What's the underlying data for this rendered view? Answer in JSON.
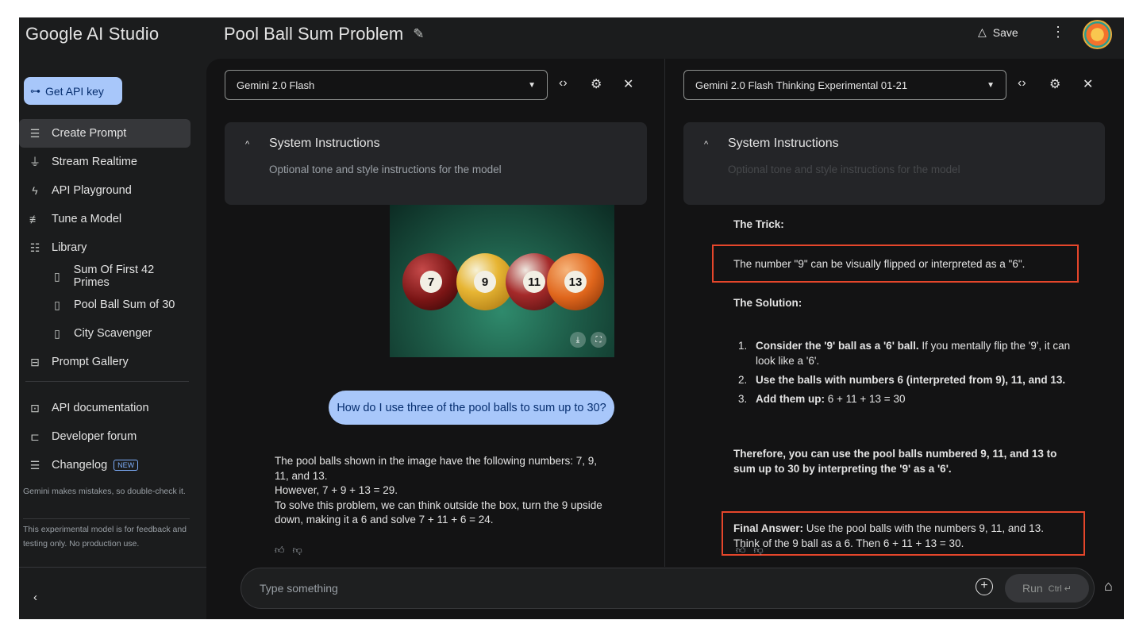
{
  "app": {
    "brand": "Google AI Studio",
    "title": "Pool Ball Sum Problem",
    "save_label": "Save"
  },
  "sidebar": {
    "api_key_label": "Get API key",
    "items": [
      {
        "label": "Create Prompt",
        "icon": "create-prompt-icon"
      },
      {
        "label": "Stream Realtime",
        "icon": "microphone-icon"
      },
      {
        "label": "API Playground",
        "icon": "bolt-icon"
      },
      {
        "label": "Tune a Model",
        "icon": "tune-icon"
      },
      {
        "label": "Library",
        "icon": "library-icon"
      },
      {
        "label": "Sum Of First 42 Primes",
        "icon": "file-icon"
      },
      {
        "label": "Pool Ball Sum of 30",
        "icon": "file-icon"
      },
      {
        "label": "City Scavenger",
        "icon": "file-icon"
      },
      {
        "label": "Prompt Gallery",
        "icon": "gallery-icon"
      }
    ],
    "links": [
      {
        "label": "API documentation",
        "icon": "docs-icon"
      },
      {
        "label": "Developer forum",
        "icon": "forum-icon"
      },
      {
        "label": "Changelog",
        "icon": "changelog-icon",
        "badge": "NEW"
      }
    ],
    "note1": "Gemini makes mistakes, so double-check it.",
    "note2": "This experimental model is for feedback and testing only. No production use."
  },
  "left": {
    "model": "Gemini 2.0 Flash",
    "system_title": "System Instructions",
    "system_placeholder": "Optional tone and style instructions for the model",
    "image": {
      "balls": [
        "7",
        "9",
        "11",
        "13"
      ]
    },
    "user_message": "How do I use three of the pool balls to sum up to 30?",
    "response": [
      "The pool balls shown in the image have the following numbers: 7, 9, 11, and 13.",
      "However, 7 + 9 + 13 = 29.",
      "To solve this problem, we can think outside the box, turn the 9 upside down, making it a 6 and solve 7 + 11 + 6 = 24."
    ]
  },
  "right": {
    "model": "Gemini 2.0 Flash Thinking Experimental 01-21",
    "system_title": "System Instructions",
    "system_placeholder": "Optional tone and style instructions for the model",
    "trick_heading": "The Trick:",
    "trick_text": "The number \"9\" can be visually flipped or interpreted as a \"6\".",
    "solution_heading": "The Solution:",
    "steps": [
      {
        "num": "1.",
        "bold": "Consider the '9' ball as a '6' ball.",
        "rest": " If you mentally flip the '9', it can look like a '6'."
      },
      {
        "num": "2.",
        "bold": "Use the balls with numbers 6 (interpreted from 9), 11, and 13.",
        "rest": ""
      },
      {
        "num": "3.",
        "bold": "Add them up:",
        "rest": " 6 + 11 + 13 = 30"
      }
    ],
    "therefore": "Therefore, you can use the pool balls numbered 9, 11, and 13 to sum up to 30 by interpreting the '9' as a '6'.",
    "final_bold": "Final Answer:",
    "final_rest": " Use the pool balls with the numbers 9, 11, and 13. Think of the 9 ball as a 6. Then 6 + 11 + 13 = 30."
  },
  "input": {
    "placeholder": "Type something",
    "run_label": "Run",
    "run_shortcut": "Ctrl ↵"
  },
  "colors": {
    "accent": "#a8c7fa",
    "highlight": "#e5462b"
  }
}
